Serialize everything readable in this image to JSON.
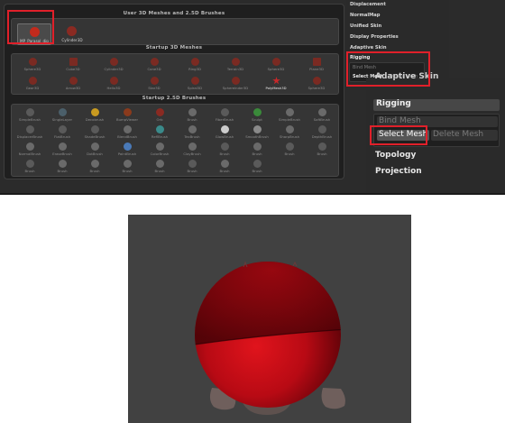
{
  "top_panel": {
    "user_meshes": {
      "title": "User 3D Meshes and 2.5D Brushes",
      "items": [
        {
          "label": "MP_Parasol_dip",
          "color": "#c22a1c"
        },
        {
          "label": "Cylinder3D",
          "color": "#8a2a22"
        }
      ]
    },
    "startup_3d": {
      "title": "Startup 3D Meshes",
      "items": [
        {
          "label": "Sphere3D",
          "icon": "sphere-icon",
          "color": "#7a2a22"
        },
        {
          "label": "Cube3D",
          "icon": "cube-icon",
          "color": "#7a2a22"
        },
        {
          "label": "Cylinder3D",
          "icon": "cylinder-icon",
          "color": "#7a2a22"
        },
        {
          "label": "Cone3D",
          "icon": "cone-icon",
          "color": "#7a2a22"
        },
        {
          "label": "Ring3D",
          "icon": "ring-icon",
          "color": "#7a2a22"
        },
        {
          "label": "Terrain3D",
          "icon": "terrain-icon",
          "color": "#7a2a22"
        },
        {
          "label": "Sphere3D",
          "icon": "sphere-icon",
          "color": "#7a2a22"
        },
        {
          "label": "Plane3D",
          "icon": "plane-icon",
          "color": "#7a2a22"
        },
        {
          "label": "Gear3D",
          "icon": "gear-icon",
          "color": "#7a2a22"
        },
        {
          "label": "Arrow3D",
          "icon": "arrow-icon",
          "color": "#7a2a22"
        },
        {
          "label": "Helix3D",
          "icon": "helix-icon",
          "color": "#7a2a22"
        },
        {
          "label": "Star3D",
          "icon": "star-icon",
          "color": "#7a2a22"
        },
        {
          "label": "Spiral3D",
          "icon": "spiral-icon",
          "color": "#7a2a22"
        },
        {
          "label": "Sphereinder3D",
          "icon": "sphere-icon",
          "color": "#7a2a22"
        },
        {
          "label": "PolyMesh3D",
          "icon": "polymesh-star-icon",
          "color": "#c8282a",
          "active": true
        },
        {
          "label": "Sphere3D",
          "icon": "sphere-icon",
          "color": "#7a2a22"
        }
      ]
    },
    "startup_brushes": {
      "title": "Startup 2.5D Brushes",
      "items": [
        {
          "label": "SimpleBrush",
          "color": "#5a5a5a"
        },
        {
          "label": "SingleLayer",
          "color": "#4b5f6a"
        },
        {
          "label": "Decobrush",
          "color": "#c89a20"
        },
        {
          "label": "BumpViewer",
          "color": "#8a3a1c"
        },
        {
          "label": "Orb",
          "color": "#8a2a22"
        },
        {
          "label": "Brush",
          "color": "#6a6a6a"
        },
        {
          "label": "FiberBrush",
          "color": "#5a5a5a"
        },
        {
          "label": "Sculpt",
          "color": "#3a8a3a"
        },
        {
          "label": "SimpleBrush",
          "color": "#6a6a6a"
        },
        {
          "label": "SoftBrush",
          "color": "#6a6a6a"
        },
        {
          "label": "DisplacerBrush",
          "color": "#5a5a5a"
        },
        {
          "label": "FlatBrush",
          "color": "#5a5a5a"
        },
        {
          "label": "ShadeBrush",
          "color": "#5a5a5a"
        },
        {
          "label": "BlendBrush",
          "color": "#6a6a6a"
        },
        {
          "label": "ReflBrush",
          "color": "#3a8a8a"
        },
        {
          "label": "TexBrush",
          "color": "#6a6a6a"
        },
        {
          "label": "GlowBrush",
          "color": "#cccccc"
        },
        {
          "label": "SmoothBrush",
          "color": "#8a8a8a"
        },
        {
          "label": "SharpBrush",
          "color": "#6a6a6a"
        },
        {
          "label": "DepthBrush",
          "color": "#5a5a5a"
        },
        {
          "label": "NormalBrush",
          "color": "#6a6a6a"
        },
        {
          "label": "EraseBrush",
          "color": "#6a6a6a"
        },
        {
          "label": "DotBrush",
          "color": "#6a6a6a"
        },
        {
          "label": "PaintBrush",
          "color": "#4a7ab8"
        },
        {
          "label": "ColorBrush",
          "color": "#6a6a6a"
        },
        {
          "label": "ClayBrush",
          "color": "#6a6a6a"
        },
        {
          "label": "Brush",
          "color": "#5a5a5a"
        },
        {
          "label": "Brush",
          "color": "#6a6a6a"
        },
        {
          "label": "Brush",
          "color": "#5a5a5a"
        },
        {
          "label": "Brush",
          "color": "#5a5a5a"
        },
        {
          "label": "Brush",
          "color": "#5a5a5a"
        },
        {
          "label": "Brush",
          "color": "#6a6a6a"
        },
        {
          "label": "Brush",
          "color": "#6a6a6a"
        },
        {
          "label": "Brush",
          "color": "#6a6a6a"
        },
        {
          "label": "Brush",
          "color": "#6a6a6a"
        },
        {
          "label": "Brush",
          "color": "#5a5a5a"
        },
        {
          "label": "Brush",
          "color": "#6a6a6a"
        },
        {
          "label": "Brush",
          "color": "#5a5a5a"
        }
      ]
    }
  },
  "small_menu": {
    "items": [
      "Displacement",
      "NormalMap",
      "Unified Skin",
      "Display Properties",
      "Adaptive Skin"
    ],
    "rigging": {
      "label": "Rigging",
      "bind_mesh": "Bind Mesh",
      "select_mesh": "Select Mesh",
      "delete_mesh": "Delete Mesh"
    }
  },
  "zoom_menu": {
    "adaptive_skin": "Adaptive Skin",
    "rigging": "Rigging",
    "bind_mesh": "Bind Mesh",
    "select_mesh": "Select Mesh",
    "delete_mesh": "Delete Mesh",
    "topology": "Topology",
    "projection": "Projection"
  },
  "viewport": {
    "object_icon": "red-sphere-on-rig",
    "colors": {
      "background": "#414141",
      "sphere": "#c8101a",
      "highlight": "#e0202a"
    }
  }
}
